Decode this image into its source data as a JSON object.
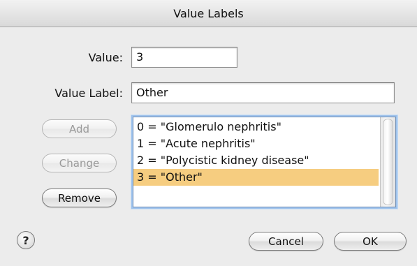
{
  "window": {
    "title": "Value Labels"
  },
  "form": {
    "value_label": "Value:",
    "value": "3",
    "value_label_label": "Value Label:",
    "value_label_value": "Other"
  },
  "buttons": {
    "add": "Add",
    "change": "Change",
    "remove": "Remove",
    "cancel": "Cancel",
    "ok": "OK",
    "help": "?"
  },
  "list": {
    "items": [
      "0 = \"Glomerulo nephritis\"",
      "1 = \"Acute nephritis\"",
      "2 = \"Polycistic kidney disease\"",
      "3 = \"Other\""
    ],
    "selected_index": 3
  },
  "colors": {
    "selection": "#f6cd80",
    "focus_ring": "#9ec2ec",
    "disabled_text": "#9a9a9a"
  }
}
